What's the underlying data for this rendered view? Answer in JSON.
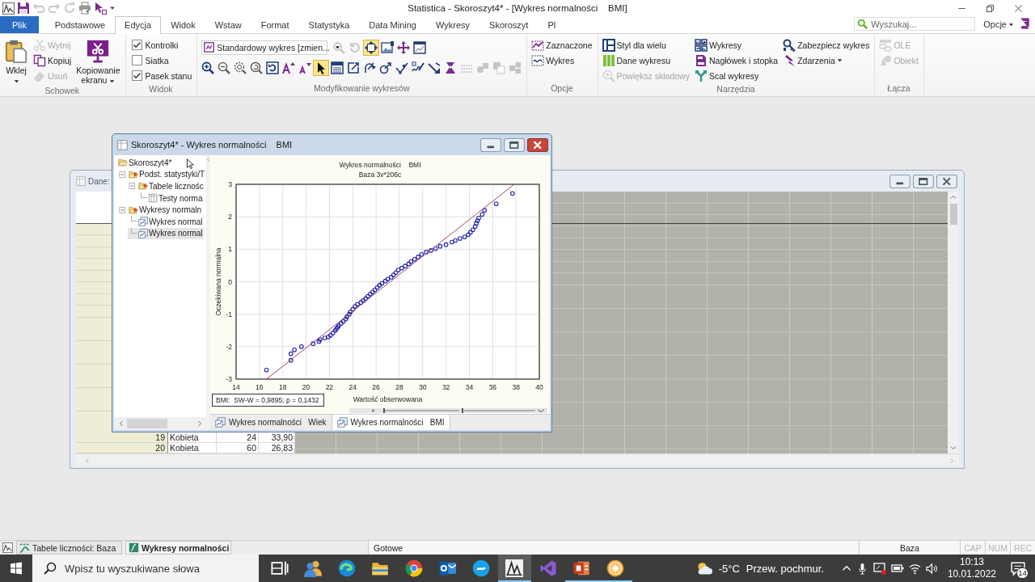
{
  "title_bar": {
    "title": "Statistica - Skoroszyt4* - [Wykres normalności    BMI]",
    "quick_access": [
      {
        "disabled": false
      },
      {
        "disabled": true
      },
      {
        "disabled": true
      },
      {
        "disabled": true
      },
      {
        "disabled": false
      },
      {
        "disabled": false
      }
    ]
  },
  "ribbon_tabs": [
    {
      "label": "Plik",
      "kind": "file",
      "selected": false
    },
    {
      "label": "Podstawowe",
      "kind": "tab",
      "selected": false
    },
    {
      "label": "Edycja",
      "kind": "tab",
      "selected": true
    },
    {
      "label": "Widok",
      "kind": "tab",
      "selected": false
    },
    {
      "label": "Wstaw",
      "kind": "tab",
      "selected": false
    },
    {
      "label": "Format",
      "kind": "tab",
      "selected": false
    },
    {
      "label": "Statystyka",
      "kind": "tab",
      "selected": false
    },
    {
      "label": "Data Mining",
      "kind": "tab",
      "selected": false
    },
    {
      "label": "Wykresy",
      "kind": "tab",
      "selected": false
    },
    {
      "label": "Skoroszyt",
      "kind": "tab",
      "selected": false
    },
    {
      "label": "Pl",
      "kind": "tab",
      "selected": false
    }
  ],
  "search": {
    "placeholder": "Wyszukaj..."
  },
  "options_menu": {
    "label": "Opcje"
  },
  "ribbon": [
    {
      "label": "Schowek",
      "columns": [
        [
          {
            "kind": "large",
            "label": "Wklej",
            "dropdown": true,
            "disabled": false
          }
        ],
        [
          {
            "kind": "small",
            "label": "Wytnij",
            "disabled": true
          },
          {
            "kind": "small",
            "label": "Kopiuj",
            "disabled": false
          },
          {
            "kind": "small",
            "label": "Usuń",
            "disabled": true
          }
        ],
        [
          {
            "kind": "large",
            "label": "Kopiowanie ekranu",
            "dropdown": true,
            "disabled": false
          }
        ]
      ]
    },
    {
      "label": "Widok",
      "columns": [
        [
          {
            "kind": "check",
            "label": "Kontrolki",
            "checked": true
          },
          {
            "kind": "check",
            "label": "Siatka",
            "checked": false
          },
          {
            "kind": "check",
            "label": "Pasek stanu",
            "checked": true
          }
        ]
      ]
    },
    {
      "label": "Modyfikowanie wykresów",
      "columns": [
        [
          {
            "kind": "tools",
            "combo_value": "Standardowy wykres [zmien...",
            "buttons": [
              {
                "selected": false,
                "disabled": true
              },
              {
                "selected": false,
                "disabled": true
              },
              {
                "selected": true,
                "disabled": false
              },
              {
                "selected": false,
                "disabled": false
              },
              {
                "selected": false,
                "disabled": false
              },
              {
                "selected": false,
                "disabled": false
              }
            ]
          },
          {
            "kind": "tools",
            "buttons": [
              {
                "selected": false,
                "disabled": false
              },
              {
                "selected": false,
                "disabled": false
              },
              {
                "selected": false,
                "disabled": false
              },
              {
                "selected": false,
                "disabled": false
              },
              {
                "selected": false,
                "disabled": false
              },
              {
                "selected": false,
                "disabled": false
              },
              {
                "selected": false,
                "disabled": false
              },
              {
                "selected": true,
                "disabled": false
              },
              {
                "selected": false,
                "disabled": false
              },
              {
                "selected": false,
                "disabled": false
              },
              {
                "selected": false,
                "disabled": false
              },
              {
                "selected": false,
                "disabled": false
              },
              {
                "selected": false,
                "disabled": false
              },
              {
                "selected": false,
                "disabled": false
              },
              {
                "selected": false,
                "disabled": false
              },
              {
                "selected": false,
                "disabled": false
              },
              {
                "selected": false,
                "disabled": true
              },
              {
                "selected": false,
                "disabled": true
              },
              {
                "selected": false,
                "disabled": true
              },
              {
                "selected": false,
                "disabled": true
              }
            ]
          }
        ]
      ]
    },
    {
      "label": "Opcje",
      "columns": [
        [
          {
            "kind": "small",
            "label": "Zaznaczone",
            "disabled": false
          },
          {
            "kind": "small",
            "label": "Wykres",
            "disabled": false
          }
        ]
      ]
    },
    {
      "label": "Narzędzia",
      "columns": [
        [
          {
            "kind": "small",
            "label": "Styl dla wielu",
            "disabled": false
          },
          {
            "kind": "small",
            "label": "Dane wykresu",
            "disabled": false
          },
          {
            "kind": "small",
            "label": "Powiększ składowy",
            "disabled": true
          }
        ],
        [
          {
            "kind": "small",
            "label": "Wykresy",
            "disabled": false
          },
          {
            "kind": "small",
            "label": "Nagłówek i stopka",
            "disabled": false
          },
          {
            "kind": "small",
            "label": "Scal wykresy",
            "disabled": false
          }
        ],
        [
          {
            "kind": "small",
            "label": "Zabezpiecz wykres",
            "disabled": false
          },
          {
            "kind": "small",
            "label": "Zdarzenia",
            "dropdown": true,
            "disabled": false
          }
        ]
      ]
    },
    {
      "label": "Łącza",
      "columns": [
        [
          {
            "kind": "small",
            "label": "OLE",
            "disabled": true
          },
          {
            "kind": "small",
            "label": "Obiekt",
            "disabled": true
          }
        ]
      ]
    }
  ],
  "data_window": {
    "title": "Dane:",
    "active": false,
    "rows": [
      {
        "number": "19",
        "cells": [
          "Kobieta",
          "24",
          "33,90"
        ]
      },
      {
        "number": "20",
        "cells": [
          "Kobieta",
          "60",
          "26,83"
        ]
      }
    ]
  },
  "workbook_window": {
    "title": "Skoroszyt4* - Wykres normalności    BMI",
    "active": true,
    "tree": [
      {
        "label": "Skoroszyt4*",
        "kind": "workbook",
        "selected": false,
        "expanded": true,
        "children": [
          {
            "label": "Podst. statystyki/T",
            "kind": "folder",
            "selected": false,
            "expanded": true,
            "children": [
              {
                "label": "Tabele licznośc",
                "kind": "folder",
                "selected": false,
                "expanded": true,
                "children": [
                  {
                    "label": "Testy norma",
                    "kind": "table",
                    "selected": false
                  }
                ]
              }
            ]
          },
          {
            "label": "Wykresy normaln",
            "kind": "folder",
            "selected": false,
            "expanded": true,
            "children": [
              {
                "label": "Wykres normal",
                "kind": "graph",
                "selected": false
              },
              {
                "label": "Wykres normal",
                "kind": "graph",
                "selected": true
              }
            ]
          }
        ]
      }
    ],
    "chart": {
      "subtitle": "Baza 3v*206c",
      "legend": "BMI:  SW-W = 0,9895; p = 0,1432",
      "chart_data": {
        "type": "scatter",
        "title": "Wykres normalności    BMI",
        "xlabel": "Wartość obserwowana",
        "ylabel": "Oczekiwana normalna",
        "x": [
          16.6,
          18.7,
          18.7,
          19.0,
          19.6,
          20.6,
          21.1,
          21.2,
          21.6,
          21.9,
          22.1,
          22.3,
          22.5,
          22.6,
          22.7,
          22.8,
          23.0,
          23.2,
          23.4,
          23.5,
          23.7,
          23.8,
          24.0,
          24.2,
          24.4,
          24.7,
          24.9,
          25.1,
          25.3,
          25.5,
          25.7,
          25.9,
          26.1,
          26.3,
          26.5,
          26.8,
          27.0,
          27.3,
          27.5,
          27.7,
          27.9,
          28.2,
          28.5,
          28.8,
          29.0,
          29.3,
          29.6,
          29.9,
          30.3,
          30.7,
          31.1,
          31.5,
          32.0,
          32.5,
          32.8,
          33.2,
          33.6,
          33.9,
          34.1,
          34.3,
          34.5,
          34.6,
          34.7,
          34.8,
          35.1,
          35.3,
          36.3,
          37.7,
          37.85
        ],
        "series": [
          {
            "type": "scatter",
            "color": "#2424a8",
            "values": [
              -2.72,
              -2.42,
              -2.22,
              -2.1,
              -2.0,
              -1.91,
              -1.84,
              -1.78,
              -1.73,
              -1.7,
              -1.65,
              -1.58,
              -1.5,
              -1.45,
              -1.4,
              -1.35,
              -1.28,
              -1.22,
              -1.15,
              -1.08,
              -1.0,
              -0.93,
              -0.85,
              -0.76,
              -0.7,
              -0.64,
              -0.58,
              -0.52,
              -0.45,
              -0.38,
              -0.32,
              -0.25,
              -0.18,
              -0.11,
              -0.05,
              0.02,
              0.08,
              0.14,
              0.21,
              0.28,
              0.36,
              0.42,
              0.48,
              0.55,
              0.62,
              0.69,
              0.76,
              0.84,
              0.91,
              0.96,
              1.02,
              1.09,
              1.14,
              1.22,
              1.27,
              1.33,
              1.38,
              1.45,
              1.52,
              1.6,
              1.7,
              1.8,
              1.88,
              1.96,
              2.07,
              2.2,
              2.4,
              2.72,
              null
            ]
          },
          {
            "type": "line",
            "color": "#a4406c",
            "values": [
              -3.0,
              -2.41,
              -2.41,
              -2.32,
              -2.15,
              -1.87,
              -1.73,
              -1.7,
              -1.59,
              -1.5,
              -1.45,
              -1.39,
              -1.33,
              -1.31,
              -1.28,
              -1.25,
              -1.19,
              -1.14,
              -1.08,
              -1.05,
              -1.0,
              -0.97,
              -0.91,
              -0.85,
              -0.8,
              -0.71,
              -0.66,
              -0.6,
              -0.54,
              -0.49,
              -0.43,
              -0.37,
              -0.32,
              -0.26,
              -0.2,
              -0.12,
              -0.06,
              0.02,
              0.08,
              0.13,
              0.19,
              0.28,
              0.36,
              0.44,
              0.5,
              0.59,
              0.67,
              0.76,
              0.87,
              0.98,
              1.09,
              1.21,
              1.35,
              1.49,
              1.57,
              1.69,
              1.8,
              1.88,
              1.94,
              2.0,
              2.05,
              2.08,
              2.11,
              2.14,
              2.22,
              2.28,
              2.56,
              2.96,
              3.0
            ]
          }
        ],
        "xlim": [
          14,
          40
        ],
        "ylim": [
          -3,
          3
        ],
        "xticks": [
          14,
          16,
          18,
          20,
          22,
          24,
          26,
          28,
          30,
          32,
          34,
          36,
          38,
          40
        ],
        "yticks": [
          -3,
          -2,
          -1,
          0,
          1,
          2,
          3
        ],
        "grid": true
      }
    },
    "tabs": [
      {
        "label": "Wykres normalności   Wiek",
        "selected": false
      },
      {
        "label": "Wykres normalności   BMI",
        "selected": true
      }
    ]
  },
  "status_bar": {
    "tabs": [
      {
        "label": "Tabele liczności: Baza",
        "kind": "table",
        "selected": false
      },
      {
        "label": "Wykresy normalności",
        "kind": "graph",
        "selected": true
      }
    ],
    "message": "Gotowe",
    "data_source": "Baza",
    "indicators": [
      {
        "label": "CAP",
        "on": false
      },
      {
        "label": "NUM",
        "on": false
      },
      {
        "label": "REC",
        "on": false
      }
    ]
  },
  "taskbar": {
    "search": {
      "placeholder": "Wpisz tu wyszukiwane słowa"
    },
    "apps": [
      {
        "running": false,
        "selected": false
      },
      {
        "running": false,
        "selected": false
      },
      {
        "running": false,
        "selected": false
      },
      {
        "running": false,
        "selected": false
      },
      {
        "running": false,
        "selected": false
      },
      {
        "running": false,
        "selected": false
      },
      {
        "running": false,
        "selected": false
      },
      {
        "running": true,
        "selected": true
      },
      {
        "running": false,
        "selected": false
      },
      {
        "running": true,
        "selected": false
      },
      {
        "running": true,
        "selected": false
      }
    ],
    "weather": {
      "temperature": "-5°C",
      "condition": "Przew. pochmur."
    },
    "clock": {
      "time": "10:13",
      "date": "10.01.2022"
    },
    "notifications": {
      "count": "14"
    }
  }
}
